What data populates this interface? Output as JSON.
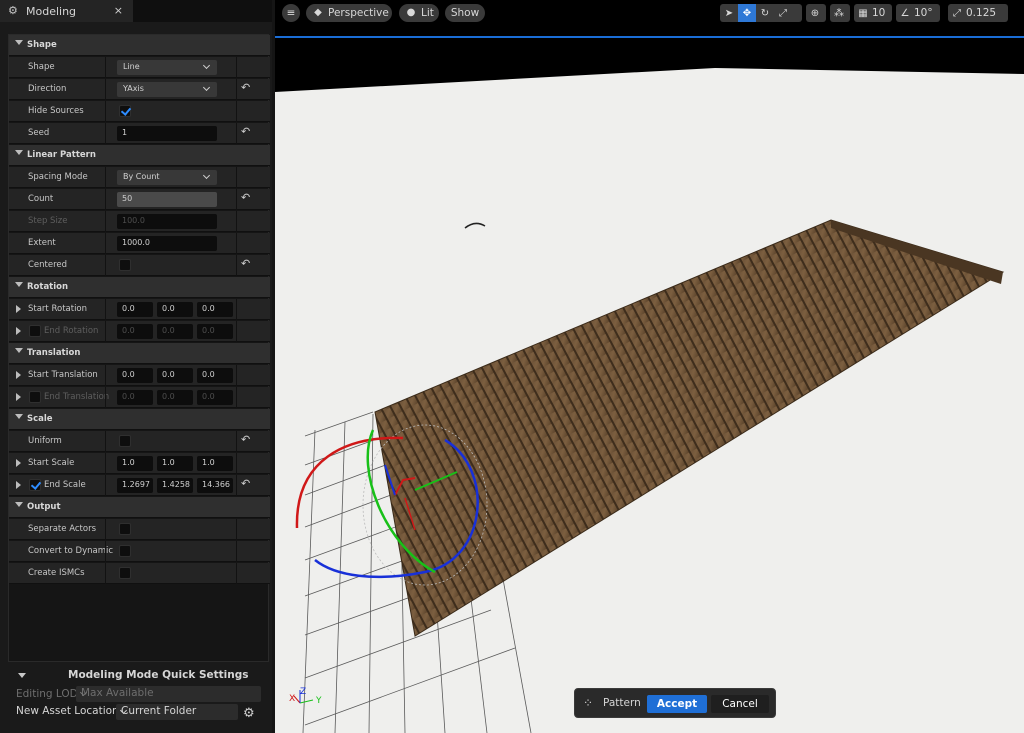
{
  "tab": {
    "title": "Modeling",
    "close": "×"
  },
  "sections": {
    "shape": "Shape",
    "linear_pattern": "Linear Pattern",
    "rotation": "Rotation",
    "translation": "Translation",
    "scale": "Scale",
    "output": "Output"
  },
  "props": {
    "shape": {
      "label": "Shape",
      "value": "Line"
    },
    "direction": {
      "label": "Direction",
      "value": "YAxis"
    },
    "hide_sources": {
      "label": "Hide Sources",
      "checked": true
    },
    "seed": {
      "label": "Seed",
      "value": "1"
    },
    "spacing_mode": {
      "label": "Spacing Mode",
      "value": "By Count"
    },
    "count": {
      "label": "Count",
      "value": "50"
    },
    "step_size": {
      "label": "Step Size",
      "value": "100.0"
    },
    "extent": {
      "label": "Extent",
      "value": "1000.0"
    },
    "centered": {
      "label": "Centered",
      "checked": false
    },
    "start_rotation": {
      "label": "Start Rotation",
      "x": "0.0",
      "y": "0.0",
      "z": "0.0"
    },
    "end_rotation": {
      "label": "End Rotation",
      "x": "0.0",
      "y": "0.0",
      "z": "0.0"
    },
    "start_translation": {
      "label": "Start Translation",
      "x": "0.0",
      "y": "0.0",
      "z": "0.0"
    },
    "end_translation": {
      "label": "End Translation",
      "x": "0.0",
      "y": "0.0",
      "z": "0.0"
    },
    "uniform": {
      "label": "Uniform",
      "checked": false
    },
    "start_scale": {
      "label": "Start Scale",
      "x": "1.0",
      "y": "1.0",
      "z": "1.0"
    },
    "end_scale": {
      "label": "End Scale",
      "x": "1.2697",
      "y": "1.4258",
      "z": "14.366",
      "checked": true
    },
    "separate_actors": {
      "label": "Separate Actors",
      "checked": false
    },
    "convert_to_dynamic": {
      "label": "Convert to Dynamic",
      "checked": false
    },
    "create_ismcs": {
      "label": "Create ISMCs",
      "checked": false
    }
  },
  "quick_settings": {
    "title": "Modeling Mode Quick Settings",
    "editing_lod_label": "Editing LOD",
    "editing_lod_value": "Max Available",
    "new_asset_location_label": "New Asset Location",
    "new_asset_location_value": "Current Folder"
  },
  "viewport": {
    "perspective": "Perspective",
    "lit": "Lit",
    "show": "Show",
    "grid_snap": "10",
    "angle_snap": "10°",
    "scale_snap": "0.125",
    "axis_x": "X",
    "axis_y": "Y",
    "axis_z": "Z"
  },
  "pattern_bar": {
    "label": "Pattern",
    "accept": "Accept",
    "cancel": "Cancel"
  },
  "colors": {
    "accent": "#2e78d6",
    "gizmo_x": "#d01818",
    "gizmo_y": "#18c018",
    "gizmo_z": "#1830d8"
  }
}
